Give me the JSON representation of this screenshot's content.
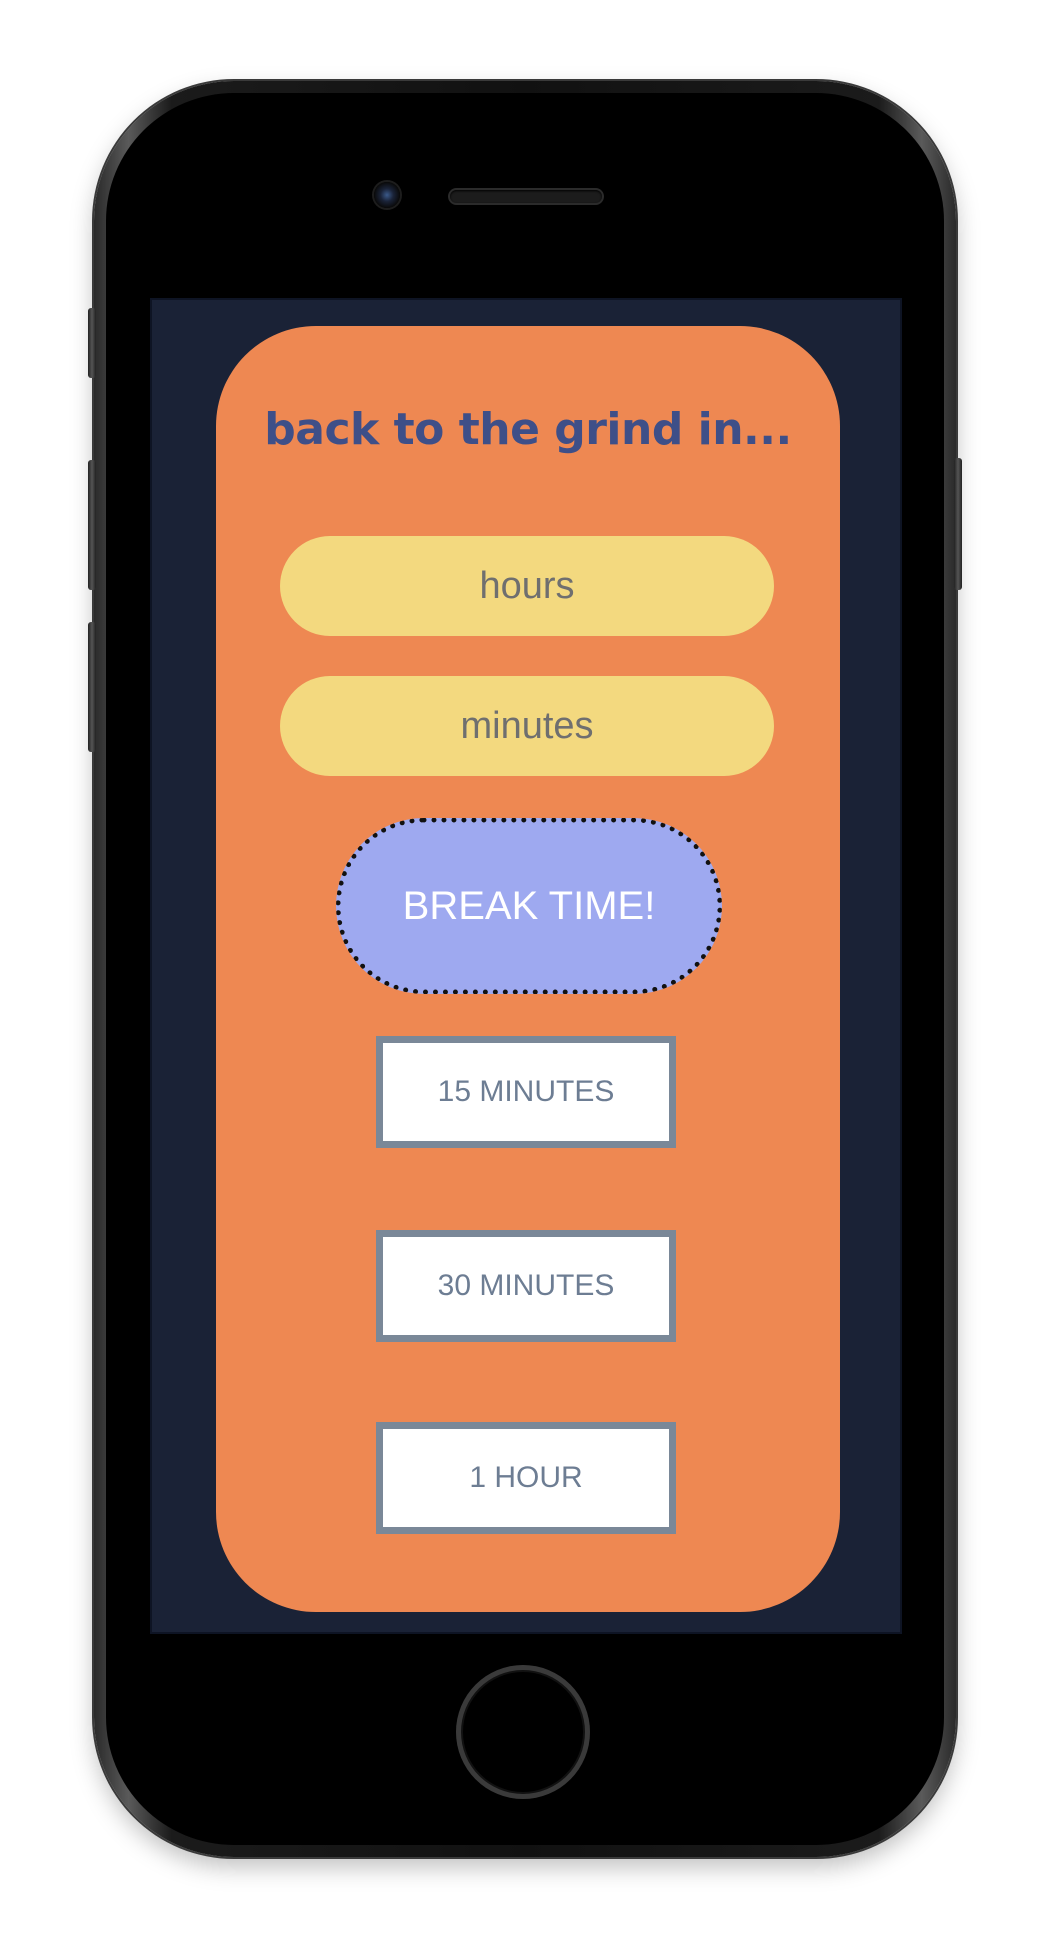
{
  "app": {
    "title": "back to the grind in..."
  },
  "inputs": {
    "hours_placeholder": "hours",
    "minutes_placeholder": "minutes"
  },
  "actions": {
    "break_label": "BREAK TIME!",
    "durations": [
      "15 MINUTES",
      "30 MINUTES",
      "1 HOUR"
    ]
  },
  "theme": {
    "screen_background": "#1a2236",
    "card_background": "#ee8852",
    "title_color": "#3e4f88",
    "input_background": "#f3d97f",
    "break_button_background": "#9ea9f0",
    "duration_border": "#7a8898"
  },
  "icons": {
    "camera": "front-camera-icon",
    "speaker": "earpiece-speaker-icon",
    "home": "home-button"
  }
}
